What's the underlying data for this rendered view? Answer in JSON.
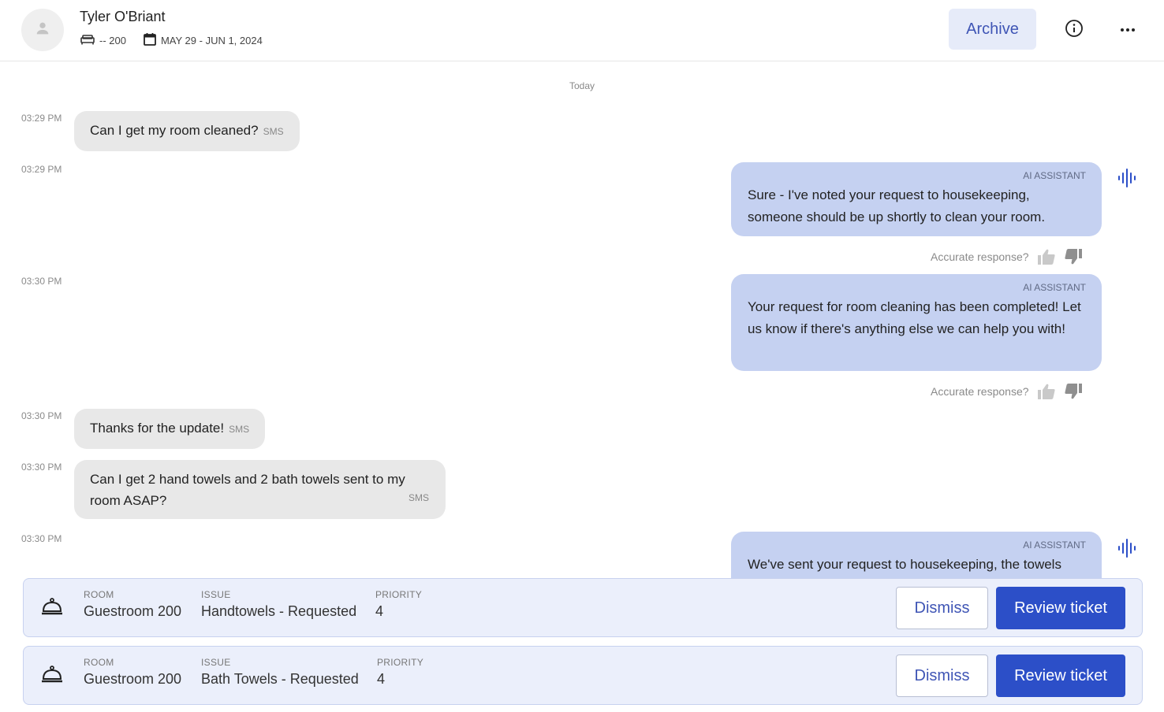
{
  "header": {
    "guest_name": "Tyler O'Briant",
    "room": "-- 200",
    "dates": "MAY 29 - JUN 1, 2024",
    "archive_label": "Archive",
    "icons": {
      "avatar": "person-icon",
      "room": "bed-icon",
      "dates": "calendar-icon",
      "info": "info-icon",
      "more": "more-horizontal-icon"
    }
  },
  "chat": {
    "day_label": "Today",
    "messages": [
      {
        "time": "03:29 PM",
        "direction": "in",
        "text": "Can I get my room cleaned?",
        "channel": "SMS"
      },
      {
        "time": "03:29 PM",
        "direction": "out",
        "sender": "AI ASSISTANT",
        "text": "Sure - I've noted your request to housekeeping, someone should be up shortly to clean your room.",
        "feedback": "Accurate response?"
      },
      {
        "time": "03:30 PM",
        "direction": "out",
        "sender": "AI ASSISTANT",
        "text": "Your request for room cleaning has been completed! Let us know if there's anything else we can help you with!",
        "feedback": "Accurate response?"
      },
      {
        "time": "03:30 PM",
        "direction": "in",
        "text": "Thanks for the update!",
        "channel": "SMS"
      },
      {
        "time": "03:30 PM",
        "direction": "in",
        "text": "Can I get 2 hand towels and 2 bath towels sent to my room ASAP?",
        "channel": "SMS"
      },
      {
        "time": "03:30 PM",
        "direction": "out",
        "sender": "AI ASSISTANT",
        "text": "We've sent your request to housekeeping, the towels"
      }
    ]
  },
  "tickets": [
    {
      "room_label": "ROOM",
      "room": "Guestroom 200",
      "issue_label": "ISSUE",
      "issue": "Handtowels - Requested",
      "priority_label": "PRIORITY",
      "priority": "4",
      "dismiss_label": "Dismiss",
      "review_label": "Review ticket"
    },
    {
      "room_label": "ROOM",
      "room": "Guestroom 200",
      "issue_label": "ISSUE",
      "issue": "Bath Towels - Requested",
      "priority_label": "PRIORITY",
      "priority": "4",
      "dismiss_label": "Dismiss",
      "review_label": "Review ticket"
    }
  ],
  "colors": {
    "accent": "#2c4fc8",
    "bubble_out": "#c5d1f1",
    "bubble_in": "#e8e8e8",
    "ticket_bg": "#ebeffb"
  }
}
